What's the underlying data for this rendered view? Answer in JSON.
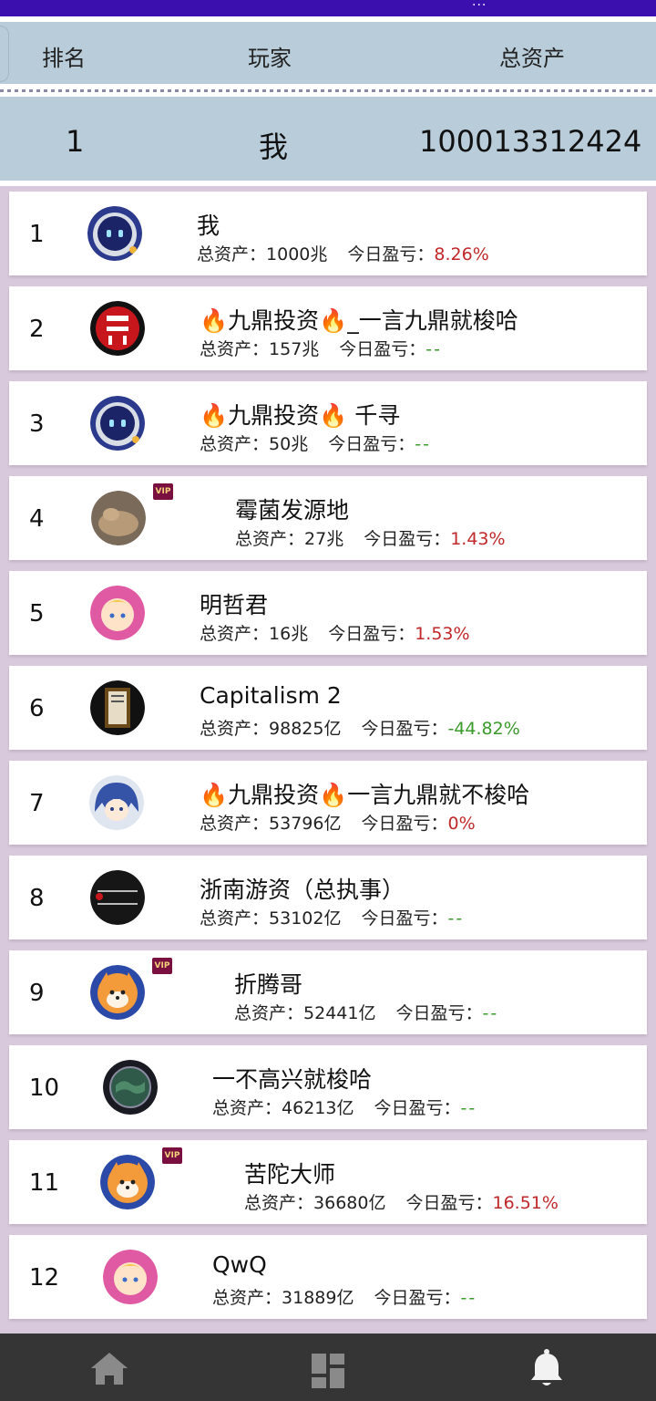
{
  "status_bar": {
    "dots": "..."
  },
  "header": {
    "rank": "排名",
    "player": "玩家",
    "assets": "总资产"
  },
  "my_row": {
    "rank": "1",
    "name": "我",
    "assets": "100013312424"
  },
  "labels": {
    "assets_prefix": "总资产：",
    "pl_prefix": "今日盈亏："
  },
  "players": [
    {
      "rank": "1",
      "name": "我",
      "assets": "1000兆",
      "pl": "8.26%",
      "pl_status": "pos",
      "avatar": "robot-avatar",
      "vip": false
    },
    {
      "rank": "2",
      "name": "🔥九鼎投资🔥_一言九鼎就梭哈",
      "assets": "157兆",
      "pl": "--",
      "pl_status": "flat",
      "avatar": "jiuding-logo-avatar",
      "vip": false
    },
    {
      "rank": "3",
      "name": "🔥九鼎投资🔥 千寻",
      "assets": "50兆",
      "pl": "--",
      "pl_status": "flat",
      "avatar": "robot-avatar",
      "vip": false
    },
    {
      "rank": "4",
      "name": "霉菌发源地",
      "assets": "27兆",
      "pl": "1.43%",
      "pl_status": "pos",
      "avatar": "clay-animal-avatar",
      "vip": true,
      "vip_label": "VIP"
    },
    {
      "rank": "5",
      "name": "明哲君",
      "assets": "16兆",
      "pl": "1.53%",
      "pl_status": "pos",
      "avatar": "anime-girl-avatar",
      "vip": false
    },
    {
      "rank": "6",
      "name": "Capitalism 2",
      "assets": "98825亿",
      "pl": "-44.82%",
      "pl_status": "neg",
      "avatar": "ornate-frame-avatar",
      "vip": false
    },
    {
      "rank": "7",
      "name": "🔥九鼎投资🔥一言九鼎就不梭哈",
      "assets": "53796亿",
      "pl": "0%",
      "pl_status": "pos",
      "avatar": "blue-hair-avatar",
      "vip": false
    },
    {
      "rank": "8",
      "name": "浙南游资（总执事）",
      "assets": "53102亿",
      "pl": "--",
      "pl_status": "flat",
      "avatar": "dark-text-avatar",
      "vip": false
    },
    {
      "rank": "9",
      "name": "折腾哥",
      "assets": "52441亿",
      "pl": "--",
      "pl_status": "flat",
      "avatar": "shiba-avatar",
      "vip": true,
      "vip_label": "VIP"
    },
    {
      "rank": "10",
      "name": "一不高兴就梭哈",
      "assets": "46213亿",
      "pl": "--",
      "pl_status": "flat",
      "avatar": "globe-avatar",
      "vip": false
    },
    {
      "rank": "11",
      "name": "苦陀大师",
      "assets": "36680亿",
      "pl": "16.51%",
      "pl_status": "pos",
      "avatar": "shiba-avatar",
      "vip": true,
      "vip_label": "VIP"
    },
    {
      "rank": "12",
      "name": "QwQ",
      "assets": "31889亿",
      "pl": "--",
      "pl_status": "flat",
      "avatar": "anime-girl-avatar",
      "vip": false
    }
  ],
  "colors": {
    "positive": "#c0282a",
    "negative": "#3a9b2a",
    "header_bg": "#b8ccd9",
    "page_bg": "#d9c9dc",
    "top_bar": "#3a0fae",
    "nav_bg": "#353535"
  },
  "bottom_nav": [
    {
      "name": "home",
      "icon": "home-icon"
    },
    {
      "name": "dashboard",
      "icon": "dashboard-icon"
    },
    {
      "name": "leaderboard",
      "icon": "bell-icon"
    }
  ]
}
